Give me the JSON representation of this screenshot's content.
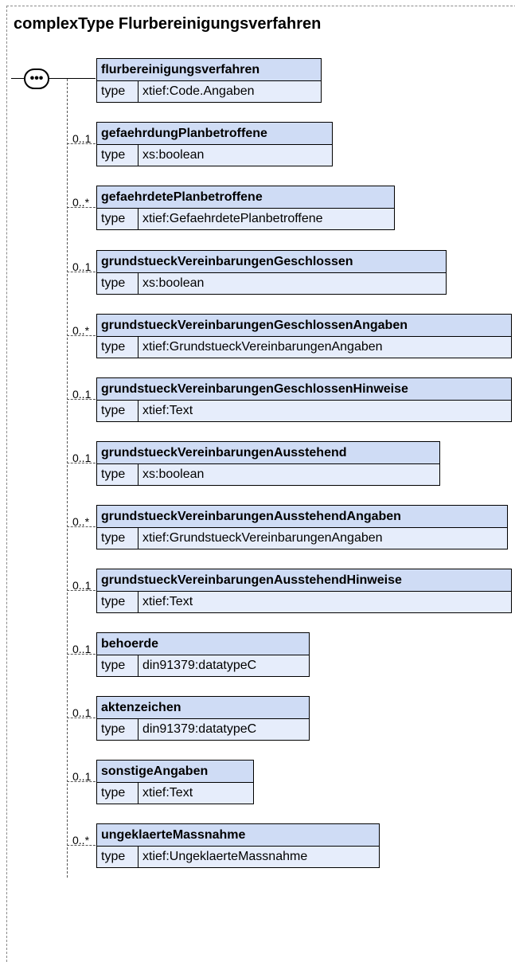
{
  "title": "complexType Flurbereinigungsverfahren",
  "compositor": {
    "icon": "sequence-icon",
    "symbol": "•••"
  },
  "elements": [
    {
      "name": "flurbereinigungsverfahren",
      "type_label": "type",
      "type": "xtief:Code.Angaben",
      "occurs": ""
    },
    {
      "name": "gefaehrdungPlanbetroffene",
      "type_label": "type",
      "type": "xs:boolean",
      "occurs": "0..1"
    },
    {
      "name": "gefaehrdetePlanbetroffene",
      "type_label": "type",
      "type": "xtief:GefaehrdetePlanbetroffene",
      "occurs": "0..*"
    },
    {
      "name": "grundstueckVereinbarungenGeschlossen",
      "type_label": "type",
      "type": "xs:boolean",
      "occurs": "0..1"
    },
    {
      "name": "grundstueckVereinbarungenGeschlossenAngaben",
      "type_label": "type",
      "type": "xtief:GrundstueckVereinbarungenAngaben",
      "occurs": "0..*"
    },
    {
      "name": "grundstueckVereinbarungenGeschlossenHinweise",
      "type_label": "type",
      "type": "xtief:Text",
      "occurs": "0..1"
    },
    {
      "name": "grundstueckVereinbarungenAusstehend",
      "type_label": "type",
      "type": "xs:boolean",
      "occurs": "0..1"
    },
    {
      "name": "grundstueckVereinbarungenAusstehendAngaben",
      "type_label": "type",
      "type": "xtief:GrundstueckVereinbarungenAngaben",
      "occurs": "0..*"
    },
    {
      "name": "grundstueckVereinbarungenAusstehendHinweise",
      "type_label": "type",
      "type": "xtief:Text",
      "occurs": "0..1"
    },
    {
      "name": "behoerde",
      "type_label": "type",
      "type": "din91379:datatypeC",
      "occurs": "0..1"
    },
    {
      "name": "aktenzeichen",
      "type_label": "type",
      "type": "din91379:datatypeC",
      "occurs": "0..1"
    },
    {
      "name": "sonstigeAngaben",
      "type_label": "type",
      "type": "xtief:Text",
      "occurs": "0..1"
    },
    {
      "name": "ungeklaerteMassnahme",
      "type_label": "type",
      "type": "xtief:UngeklaerteMassnahme",
      "occurs": "0..*"
    }
  ]
}
